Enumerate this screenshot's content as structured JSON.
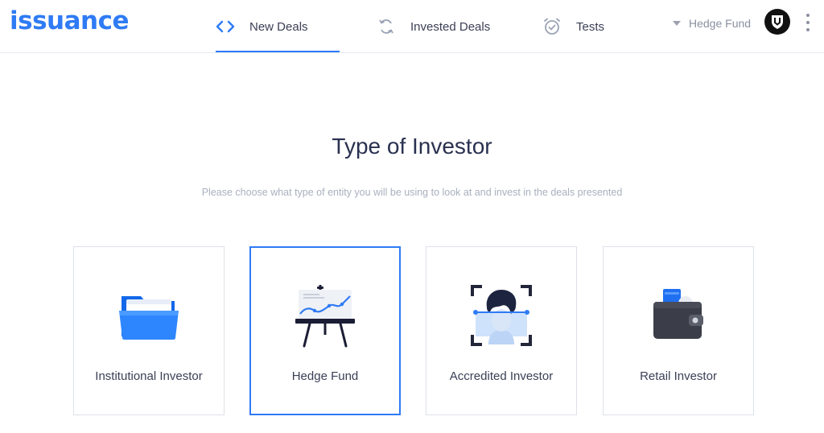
{
  "brand": {
    "logo_text": "issuance",
    "accent_color": "#2f7bf5"
  },
  "nav": {
    "tabs": [
      {
        "label": "New Deals",
        "icon": "code-brackets-icon",
        "active": true
      },
      {
        "label": "Invested Deals",
        "icon": "refresh-icon",
        "active": false
      },
      {
        "label": "Tests",
        "icon": "alarm-clock-check-icon",
        "active": false
      }
    ]
  },
  "account": {
    "selected": "Hedge Fund",
    "avatar_icon": "shield-logo-icon",
    "menu_icon": "kebab-menu-icon"
  },
  "main": {
    "title": "Type of Investor",
    "subtitle": "Please choose what type of entity you will be using to look at and invest in the deals presented",
    "options": [
      {
        "label": "Institutional Investor",
        "icon": "folder-icon",
        "selected": false
      },
      {
        "label": "Hedge Fund",
        "icon": "chart-easel-icon",
        "selected": true
      },
      {
        "label": "Accredited Investor",
        "icon": "face-scan-icon",
        "selected": false
      },
      {
        "label": "Retail Investor",
        "icon": "wallet-icon",
        "selected": false
      }
    ]
  }
}
